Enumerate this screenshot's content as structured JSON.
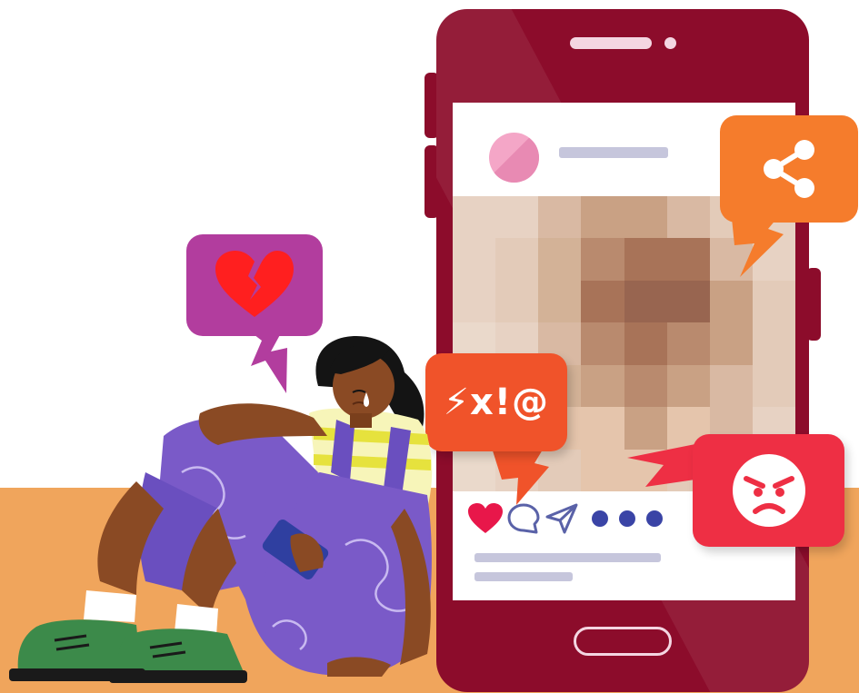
{
  "illustration": {
    "bubbles": {
      "heart": {
        "icon": "broken-heart-icon",
        "color": "#b23d9e"
      },
      "share": {
        "icon": "share-icon",
        "color": "#f57c2c"
      },
      "curse": {
        "text": "⚡x!@",
        "color": "#f0532a"
      },
      "angry": {
        "icon": "angry-face-icon",
        "color": "#ee2f44"
      }
    },
    "post": {
      "actions": [
        "heart-icon",
        "comment-icon",
        "send-icon",
        "more-icon"
      ],
      "like_color": "#e8174a"
    },
    "colors": {
      "phone": "#8c0c2b",
      "floor": "#f0a55c",
      "overalls": "#7a5ac8",
      "shoes": "#3c8a4a"
    }
  }
}
